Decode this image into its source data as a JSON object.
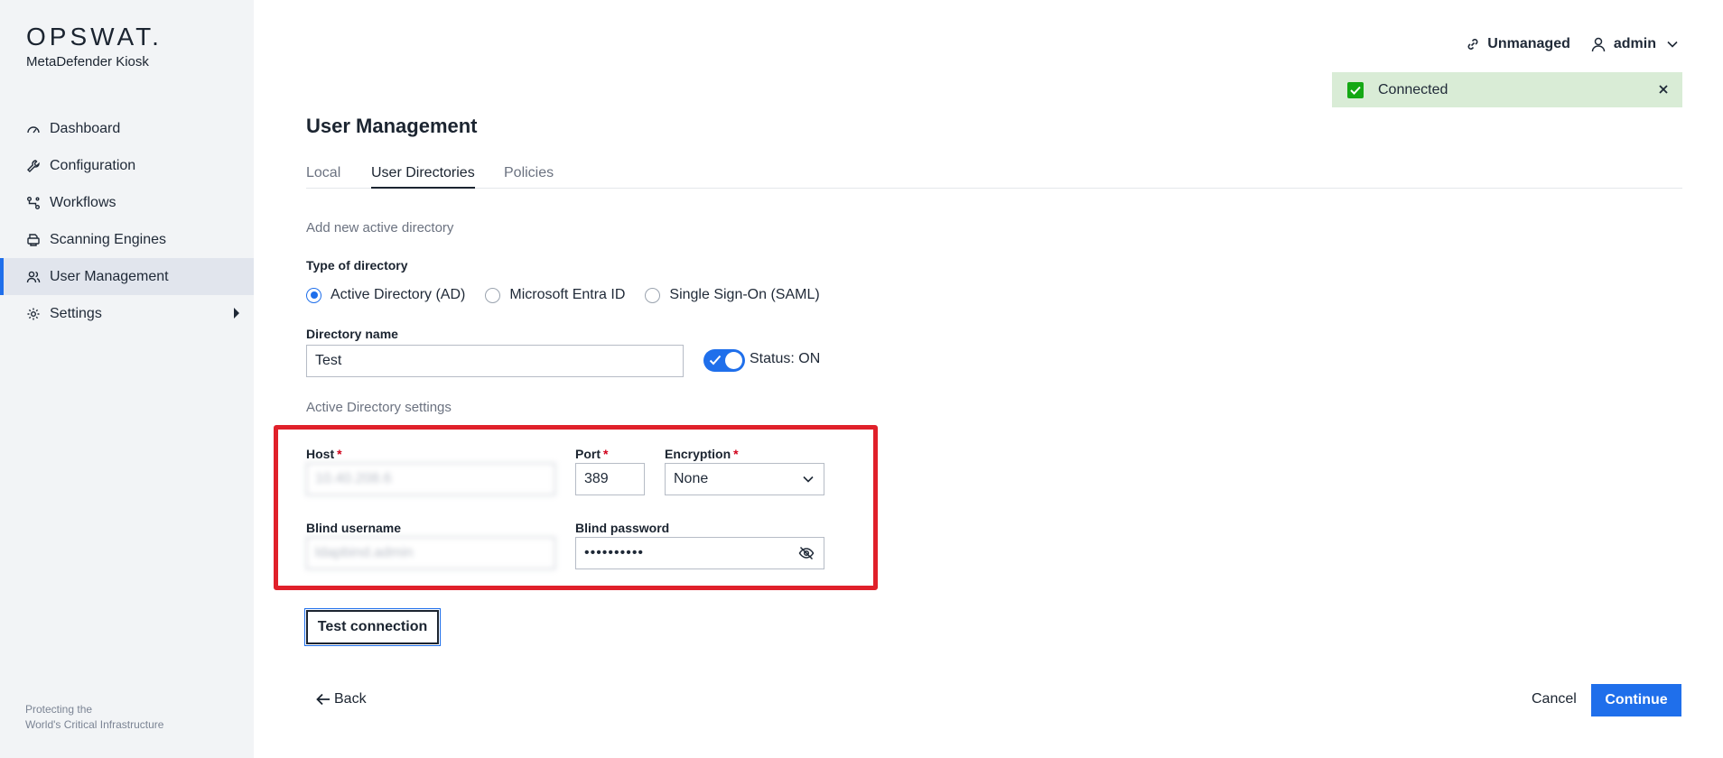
{
  "brand": {
    "name": "OPSWAT.",
    "product": "MetaDefender Kiosk"
  },
  "sidebar": {
    "items": [
      {
        "label": "Dashboard",
        "icon": "gauge-icon"
      },
      {
        "label": "Configuration",
        "icon": "wrench-icon"
      },
      {
        "label": "Workflows",
        "icon": "workflow-icon"
      },
      {
        "label": "Scanning Engines",
        "icon": "printer-icon"
      },
      {
        "label": "User Management",
        "icon": "users-icon",
        "active": true
      },
      {
        "label": "Settings",
        "icon": "gear-icon"
      }
    ],
    "footer_line1": "Protecting the",
    "footer_line2": "World's Critical Infrastructure"
  },
  "header": {
    "unmanaged_label": "Unmanaged",
    "user_label": "admin"
  },
  "toast": {
    "message": "Connected"
  },
  "page": {
    "title": "User Management",
    "tabs": [
      "Local",
      "User Directories",
      "Policies"
    ],
    "add_section_label": "Add new active directory",
    "type_label": "Type of directory",
    "directory_types": [
      "Active Directory (AD)",
      "Microsoft Entra ID",
      "Single Sign-On (SAML)"
    ],
    "directory_name_label": "Directory name",
    "directory_name_value": "Test",
    "status_label": "Status: ON",
    "ad_settings_label": "Active Directory settings"
  },
  "form": {
    "host_label": "Host",
    "host_value": "10.40.208.6",
    "port_label": "Port",
    "port_value": "389",
    "encryption_label": "Encryption",
    "encryption_value": "None",
    "blind_username_label": "Blind username",
    "blind_username_value": "ldapbind.admin",
    "blind_password_label": "Blind password",
    "blind_password_value": "••••••••••",
    "required_mark": "*"
  },
  "actions": {
    "test_connection": "Test connection",
    "back": "Back",
    "cancel": "Cancel",
    "continue": "Continue"
  },
  "colors": {
    "accent": "#1f6feb",
    "highlight": "#e0202a",
    "success_bg": "#d9ecd6",
    "success": "#14a814"
  }
}
